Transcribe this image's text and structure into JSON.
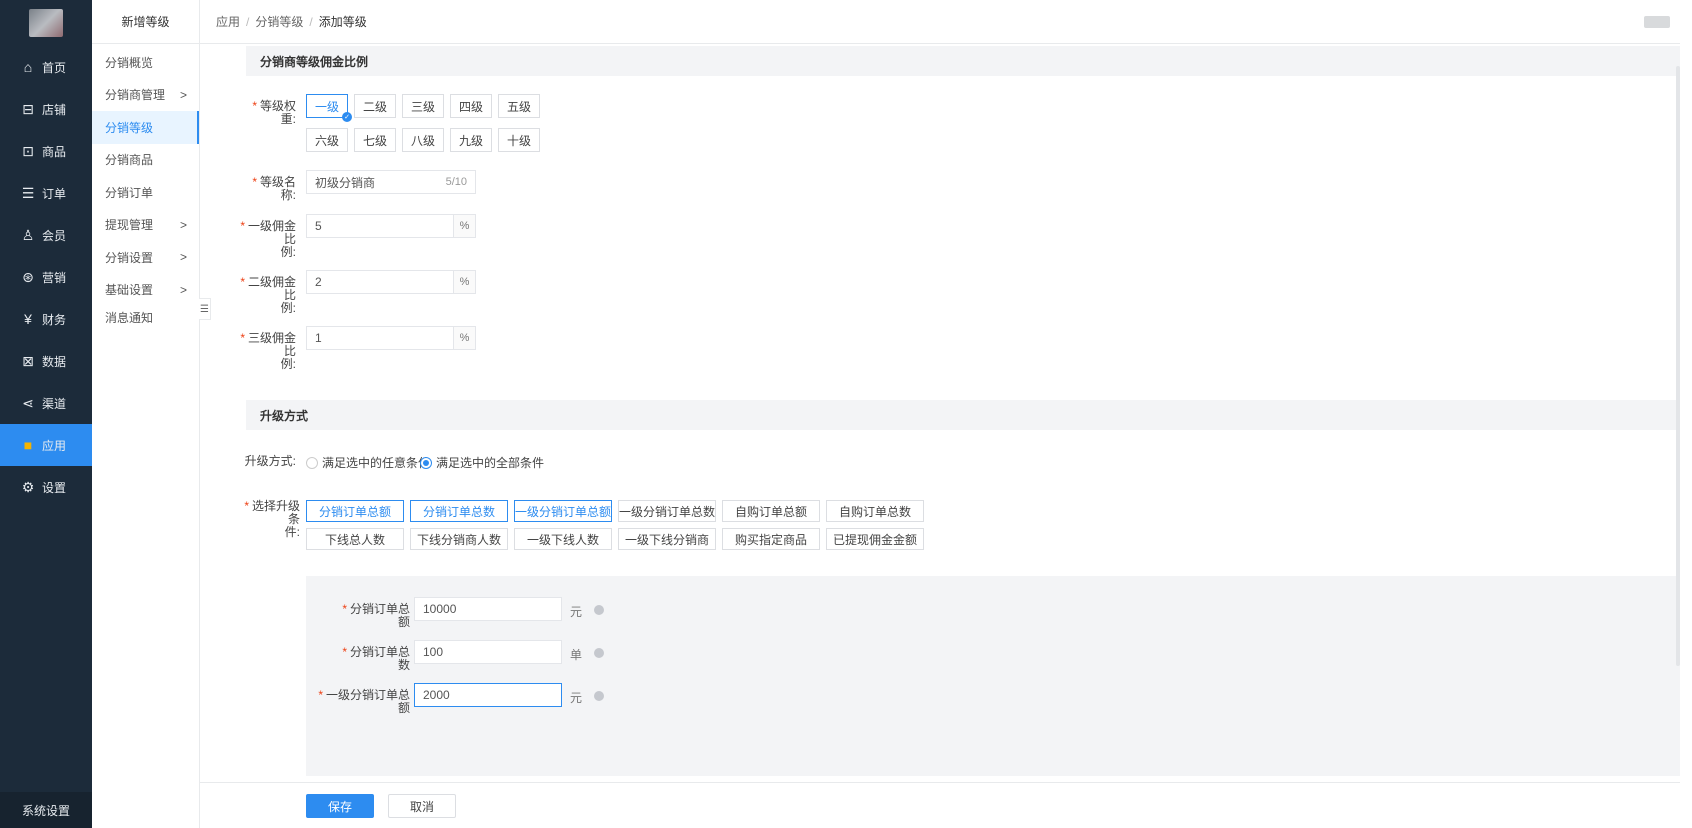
{
  "nav": {
    "items": [
      {
        "label": "首页",
        "icon": "⌂",
        "icon_name": "home-icon"
      },
      {
        "label": "店铺",
        "icon": "⊟",
        "icon_name": "store-icon"
      },
      {
        "label": "商品",
        "icon": "⊡",
        "icon_name": "goods-icon"
      },
      {
        "label": "订单",
        "icon": "☰",
        "icon_name": "order-icon"
      },
      {
        "label": "会员",
        "icon": "♙",
        "icon_name": "member-icon"
      },
      {
        "label": "营销",
        "icon": "⊛",
        "icon_name": "marketing-icon"
      },
      {
        "label": "财务",
        "icon": "¥",
        "icon_name": "finance-icon"
      },
      {
        "label": "数据",
        "icon": "⊠",
        "icon_name": "data-icon"
      },
      {
        "label": "渠道",
        "icon": "⋖",
        "icon_name": "channel-icon"
      },
      {
        "label": "应用",
        "icon": "■",
        "icon_name": "apps-icon"
      },
      {
        "label": "设置",
        "icon": "⚙",
        "icon_name": "settings-icon"
      }
    ],
    "bottom_label": "系统设置"
  },
  "submenu": {
    "head": "新增等级",
    "items": [
      {
        "label": "分销概览",
        "arrow": ""
      },
      {
        "label": "分销商管理",
        "arrow": ">"
      },
      {
        "label": "分销等级",
        "arrow": ""
      },
      {
        "label": "分销商品",
        "arrow": ""
      },
      {
        "label": "分销订单",
        "arrow": ""
      },
      {
        "label": "提现管理",
        "arrow": ">"
      },
      {
        "label": "分销设置",
        "arrow": ">"
      },
      {
        "label": "基础设置",
        "arrow": ">"
      },
      {
        "label": "消息通知",
        "arrow": ""
      }
    ],
    "collapse_icon": "☰"
  },
  "breadcrumb": {
    "a": "应用",
    "b": "分销等级",
    "c": "添加等级",
    "sep": "/"
  },
  "section1": {
    "title": "分销商等级佣金比例",
    "level_weight_label": "等级权重:",
    "levels": [
      "一级",
      "二级",
      "三级",
      "四级",
      "五级",
      "六级",
      "七级",
      "八级",
      "九级",
      "十级"
    ],
    "selected_level": "一级",
    "name_label": "等级名称:",
    "name_value": "初级分销商",
    "name_count": "5/10",
    "rate1_label_a": "一级佣金比",
    "rate1_label_b": "例:",
    "rate1_value": "5",
    "rate2_label_a": "二级佣金比",
    "rate2_label_b": "例:",
    "rate2_value": "2",
    "rate3_label_a": "三级佣金比",
    "rate3_label_b": "例:",
    "rate3_value": "1",
    "percent": "%"
  },
  "section2": {
    "title": "升级方式",
    "mode_label": "升级方式:",
    "mode_any": "满足选中的任意条件",
    "mode_all": "满足选中的全部条件",
    "cond_label_a": "选择升级条",
    "cond_label_b": "件:",
    "conditions": [
      {
        "label": "分销订单总额",
        "selected": true
      },
      {
        "label": "分销订单总数",
        "selected": true
      },
      {
        "label": "一级分销订单总额",
        "selected": true
      },
      {
        "label": "一级分销订单总数",
        "selected": false
      },
      {
        "label": "自购订单总额",
        "selected": false
      },
      {
        "label": "自购订单总数",
        "selected": false
      },
      {
        "label": "下线总人数",
        "selected": false
      },
      {
        "label": "下线分销商人数",
        "selected": false
      },
      {
        "label": "一级下线人数",
        "selected": false
      },
      {
        "label": "一级下线分销商",
        "selected": false
      },
      {
        "label": "购买指定商品",
        "selected": false
      },
      {
        "label": "已提现佣金金额",
        "selected": false
      }
    ],
    "f1_label": "分销订单总额",
    "f1_value": "10000",
    "f1_unit": "元",
    "f2_label": "分销订单总数",
    "f2_value": "100",
    "f2_unit": "单",
    "f3_label": "一级分销订单总额",
    "f3_value": "2000",
    "f3_unit": "元"
  },
  "footer": {
    "save": "保存",
    "cancel": "取消"
  },
  "req_mark": "*",
  "colors": {
    "primary": "#2d8cf0",
    "nav_bg": "#1c2b3a",
    "required": "#ed4014"
  }
}
